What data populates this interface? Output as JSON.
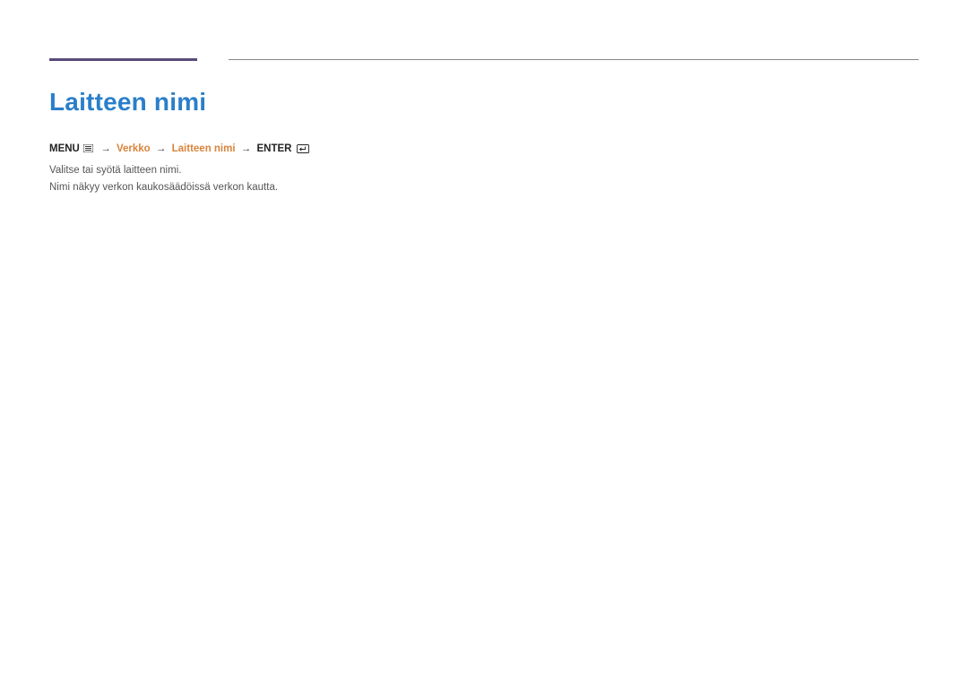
{
  "title": "Laitteen nimi",
  "breadcrumb": {
    "menu": "MENU",
    "arrow": "→",
    "verkko": "Verkko",
    "laitteen_nimi": "Laitteen nimi",
    "enter": "ENTER"
  },
  "body": {
    "line1": "Valitse tai syötä laitteen nimi.",
    "line2": "Nimi näkyy verkon kaukosäädöissä verkon kautta."
  }
}
